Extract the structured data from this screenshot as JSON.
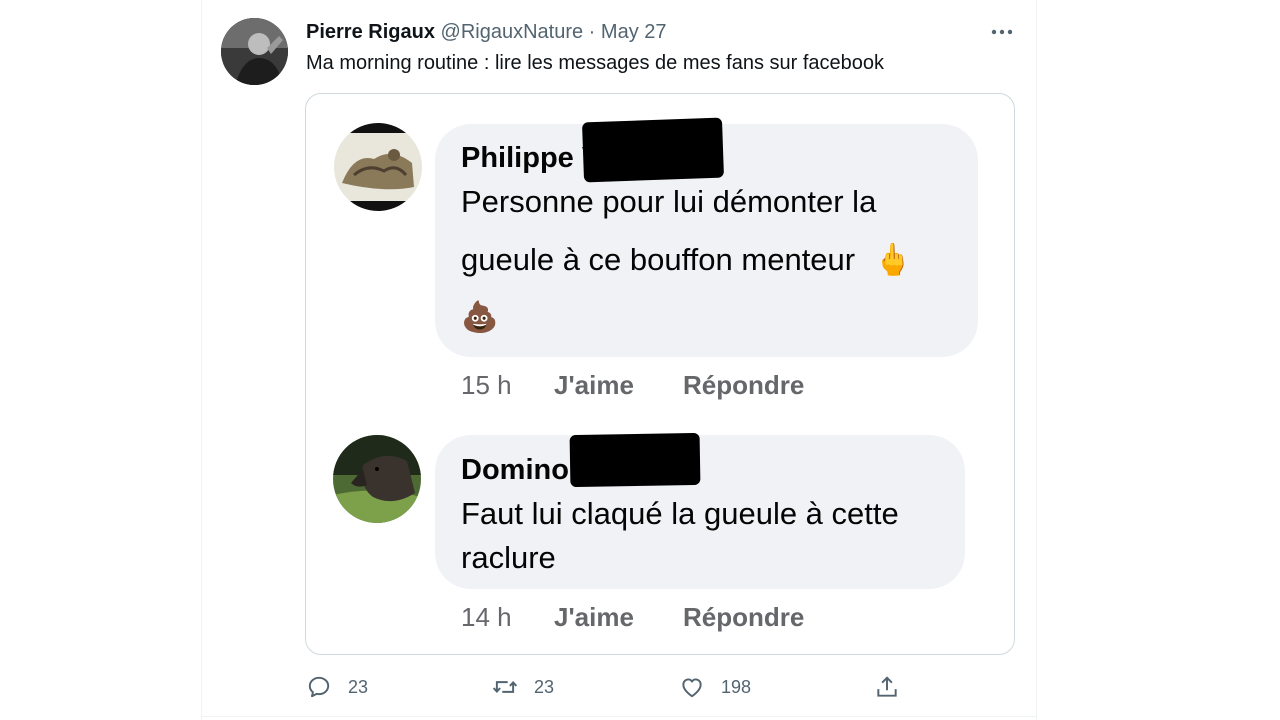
{
  "tweet": {
    "author_name": "Pierre Rigaux",
    "handle": "@RigauxNature",
    "separator": "·",
    "date": "May 27",
    "text": "Ma morning routine : lire les messages de mes fans sur facebook",
    "more_icon": "more-horizontal-icon"
  },
  "embedded_screenshot": {
    "comments": [
      {
        "name": "Philippe V",
        "lines": [
          "Personne pour lui démonter la",
          "gueule à ce bouffon menteur",
          "💩"
        ],
        "emoji_inline": "🖕",
        "time": "15 h",
        "like": "J'aime",
        "reply": "Répondre"
      },
      {
        "name": "Domino B",
        "lines": [
          "Faut lui claqué la gueule à cette",
          "raclure"
        ],
        "time": "14 h",
        "like": "J'aime",
        "reply": "Répondre"
      }
    ]
  },
  "actions": {
    "reply_count": "23",
    "retweet_count": "23",
    "like_count": "198"
  },
  "colors": {
    "secondary_text": "#536471",
    "bubble_bg": "#f0f2f5",
    "card_border": "#cfd9de"
  }
}
